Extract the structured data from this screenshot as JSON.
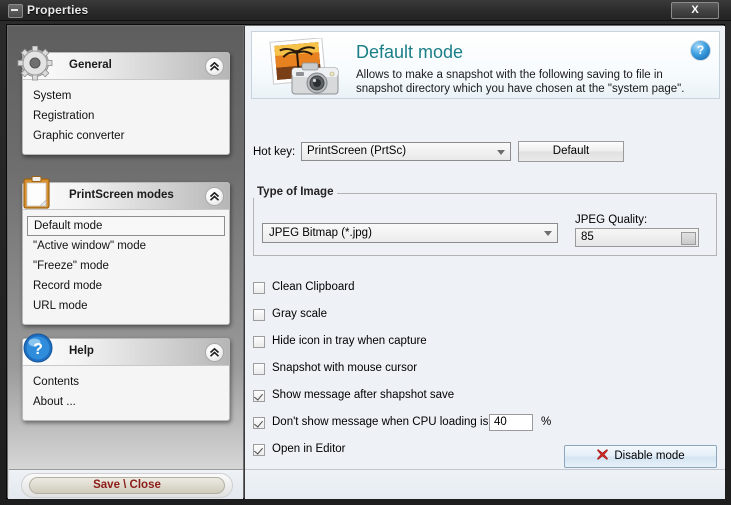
{
  "window": {
    "title": "Properties",
    "sysmenu_icon": "minimize-box-icon",
    "close_label": "X"
  },
  "sidebar": {
    "sections": [
      {
        "id": "general",
        "title": "General",
        "icon": "gear-icon",
        "collapse_icon": "double-chevron-up-icon",
        "items": [
          {
            "label": "System",
            "selected": false
          },
          {
            "label": "Registration",
            "selected": false
          },
          {
            "label": "Graphic converter",
            "selected": false
          }
        ]
      },
      {
        "id": "printscreen-modes",
        "title": "PrintScreen modes",
        "icon": "clipboard-icon",
        "collapse_icon": "double-chevron-up-icon",
        "items": [
          {
            "label": "Default mode",
            "selected": true
          },
          {
            "label": "\"Active window\" mode",
            "selected": false
          },
          {
            "label": "\"Freeze\" mode",
            "selected": false
          },
          {
            "label": "Record mode",
            "selected": false
          },
          {
            "label": "URL mode",
            "selected": false
          }
        ]
      },
      {
        "id": "help",
        "title": "Help",
        "icon": "blue-question-icon",
        "collapse_icon": "double-chevron-up-icon",
        "items": [
          {
            "label": "Contents",
            "selected": false
          },
          {
            "label": "About ...",
            "selected": false
          }
        ]
      }
    ],
    "save_close_label": "Save \\ Close"
  },
  "main": {
    "header": {
      "icon": "photo-camera-icon",
      "title": "Default mode",
      "description": "Allows to make a snapshot with the following saving to file in snapshot directory which you have chosen at the \"system page\".",
      "help_icon": "help-circle-icon",
      "help_label": "?"
    },
    "hotkey": {
      "label": "Hot key:",
      "value": "PrintScreen (PrtSc)",
      "dropdown_icon": "chevron-down-icon",
      "default_button": "Default"
    },
    "type_of_image": {
      "legend": "Type of Image",
      "format_value": "JPEG Bitmap (*.jpg)",
      "format_dropdown_icon": "chevron-down-icon",
      "quality_label": "JPEG Quality:",
      "quality_value": "85",
      "quality_spin_icon": "spinner-icon"
    },
    "options": [
      {
        "label": "Clean Clipboard",
        "checked": false
      },
      {
        "label": "Gray scale",
        "checked": false
      },
      {
        "label": "Hide icon in tray when capture",
        "checked": false
      },
      {
        "label": "Snapshot with mouse cursor",
        "checked": false
      },
      {
        "label": "Show message after shapshot save",
        "checked": true
      },
      {
        "label": "Don't show message when CPU loading is",
        "checked": true
      },
      {
        "label": "Open in Editor",
        "checked": true
      }
    ],
    "cpu_loading": {
      "value": "40",
      "unit": "%"
    },
    "disable_button": {
      "label": "Disable mode",
      "icon": "red-x-icon"
    }
  },
  "colors": {
    "title_accent": "#1a7f86",
    "save_close_text": "#8c1c17",
    "disable_x": "#d02a25",
    "titlebar": "#2a2a2a",
    "sidebar_top": "#5e5e5e",
    "content_bg": "#eef1f5"
  }
}
